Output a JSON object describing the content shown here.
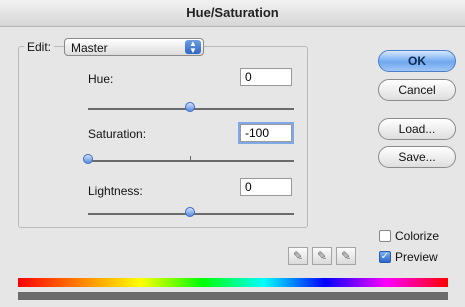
{
  "window": {
    "title": "Hue/Saturation"
  },
  "edit": {
    "label": "Edit:",
    "value": "Master"
  },
  "sliders": {
    "hue": {
      "label": "Hue:",
      "value": "0"
    },
    "saturation": {
      "label": "Saturation:",
      "value": "-100"
    },
    "lightness": {
      "label": "Lightness:",
      "value": "0"
    }
  },
  "buttons": {
    "ok": "OK",
    "cancel": "Cancel",
    "load": "Load...",
    "save": "Save..."
  },
  "options": {
    "colorize": "Colorize",
    "preview": "Preview",
    "colorize_checked": false,
    "preview_checked": true
  },
  "icons": [
    "eyedropper-icon",
    "eyedropper-plus-icon",
    "eyedropper-minus-icon"
  ],
  "colors": {
    "accent": "#4d7fc6",
    "window_bg": "#e6e6e6"
  }
}
